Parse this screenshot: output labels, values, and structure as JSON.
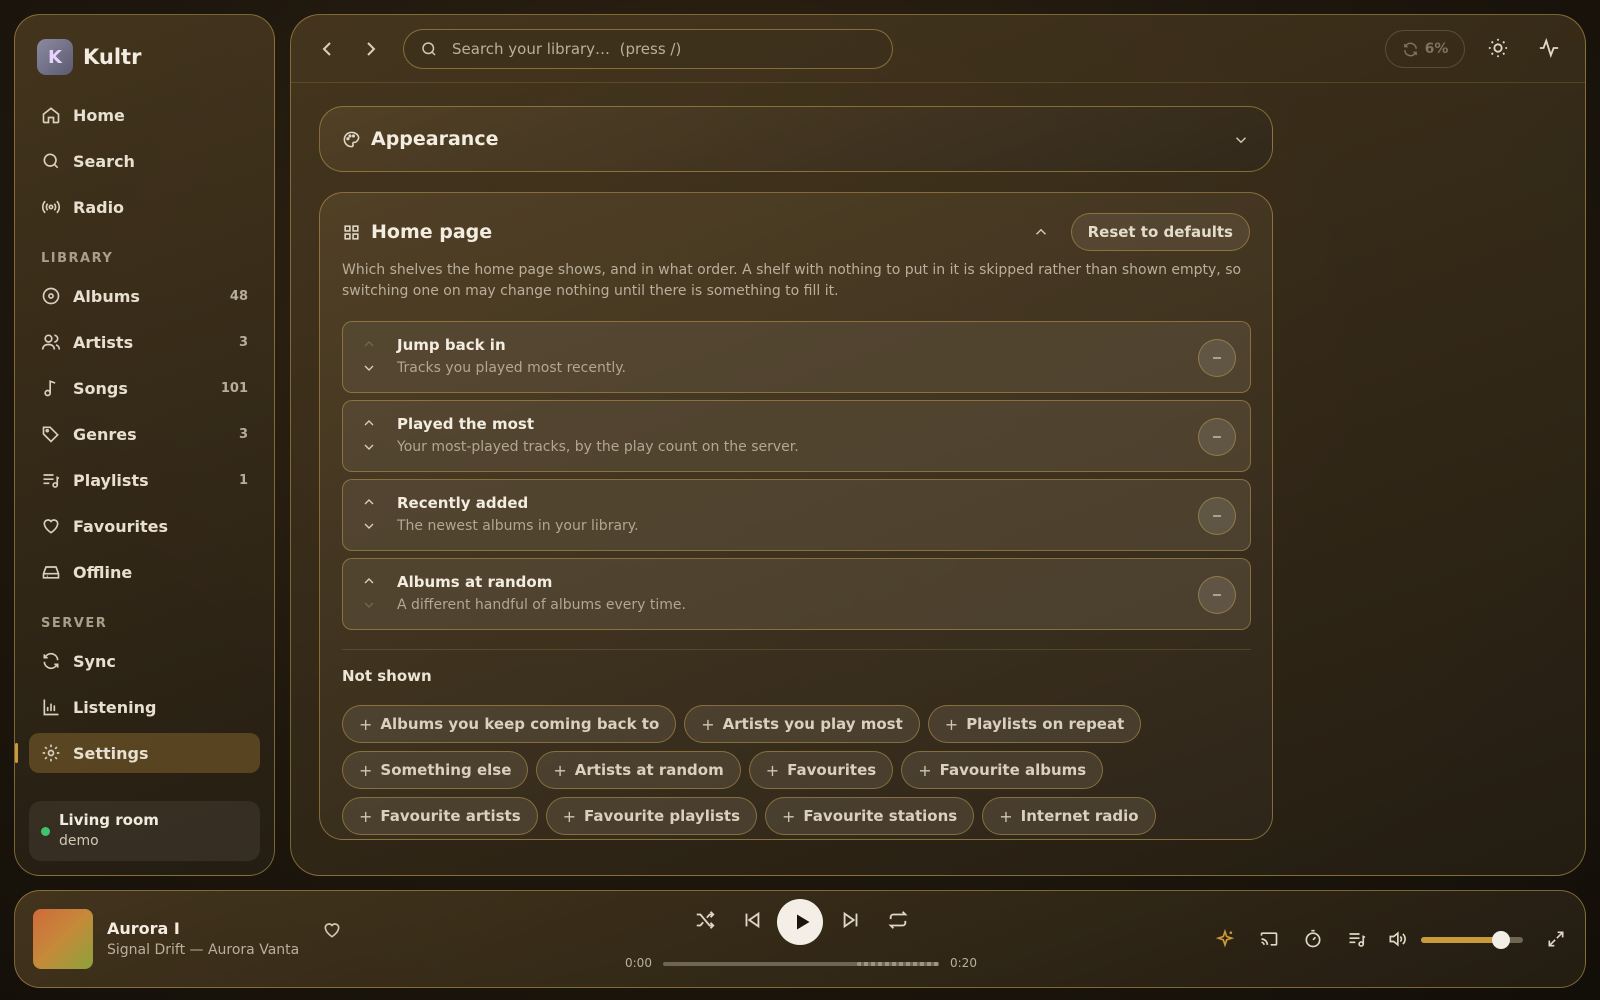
{
  "app": {
    "name": "Kultr"
  },
  "sidebar": {
    "nav": [
      {
        "label": "Home",
        "icon": "home-icon"
      },
      {
        "label": "Search",
        "icon": "search-icon"
      },
      {
        "label": "Radio",
        "icon": "radio-icon"
      }
    ],
    "library_heading": "LIBRARY",
    "library": [
      {
        "label": "Albums",
        "count": "48",
        "icon": "album-icon"
      },
      {
        "label": "Artists",
        "count": "3",
        "icon": "artists-icon"
      },
      {
        "label": "Songs",
        "count": "101",
        "icon": "music-note-icon"
      },
      {
        "label": "Genres",
        "count": "3",
        "icon": "tag-icon"
      },
      {
        "label": "Playlists",
        "count": "1",
        "icon": "playlist-icon"
      },
      {
        "label": "Favourites",
        "count": "",
        "icon": "heart-icon"
      },
      {
        "label": "Offline",
        "count": "",
        "icon": "drive-icon"
      }
    ],
    "server_heading": "SERVER",
    "server": [
      {
        "label": "Sync",
        "icon": "sync-icon"
      },
      {
        "label": "Listening",
        "icon": "bar-chart-icon"
      },
      {
        "label": "Settings",
        "icon": "gear-icon",
        "active": true
      }
    ],
    "device": {
      "name": "Living room",
      "user": "demo",
      "status_color": "#3fc46d"
    }
  },
  "topbar": {
    "search_placeholder": "Search your library…  (press /)",
    "sync_percent": "6%"
  },
  "appearance": {
    "title": "Appearance"
  },
  "home_page": {
    "title": "Home page",
    "reset_label": "Reset to defaults",
    "description": "Which shelves the home page shows, and in what order. A shelf with nothing to put in it is skipped rather than shown empty, so switching one on may change nothing until there is something to fill it.",
    "shelves": [
      {
        "title": "Jump back in",
        "subtitle": "Tracks you played most recently."
      },
      {
        "title": "Played the most",
        "subtitle": "Your most-played tracks, by the play count on the server."
      },
      {
        "title": "Recently added",
        "subtitle": "The newest albums in your library."
      },
      {
        "title": "Albums at random",
        "subtitle": "A different handful of albums every time."
      }
    ],
    "not_shown_title": "Not shown",
    "not_shown": [
      "Albums you keep coming back to",
      "Artists you play most",
      "Playlists on repeat",
      "Something else",
      "Artists at random",
      "Favourites",
      "Favourite albums",
      "Favourite artists",
      "Favourite playlists",
      "Favourite stations",
      "Internet radio"
    ]
  },
  "player": {
    "title": "Aurora I",
    "subtitle": "Signal Drift — Aurora Vanta",
    "elapsed": "0:00",
    "duration": "0:20",
    "progress_fraction": 0.0,
    "volume_fraction": 0.78,
    "accent": "#c99a3a"
  }
}
